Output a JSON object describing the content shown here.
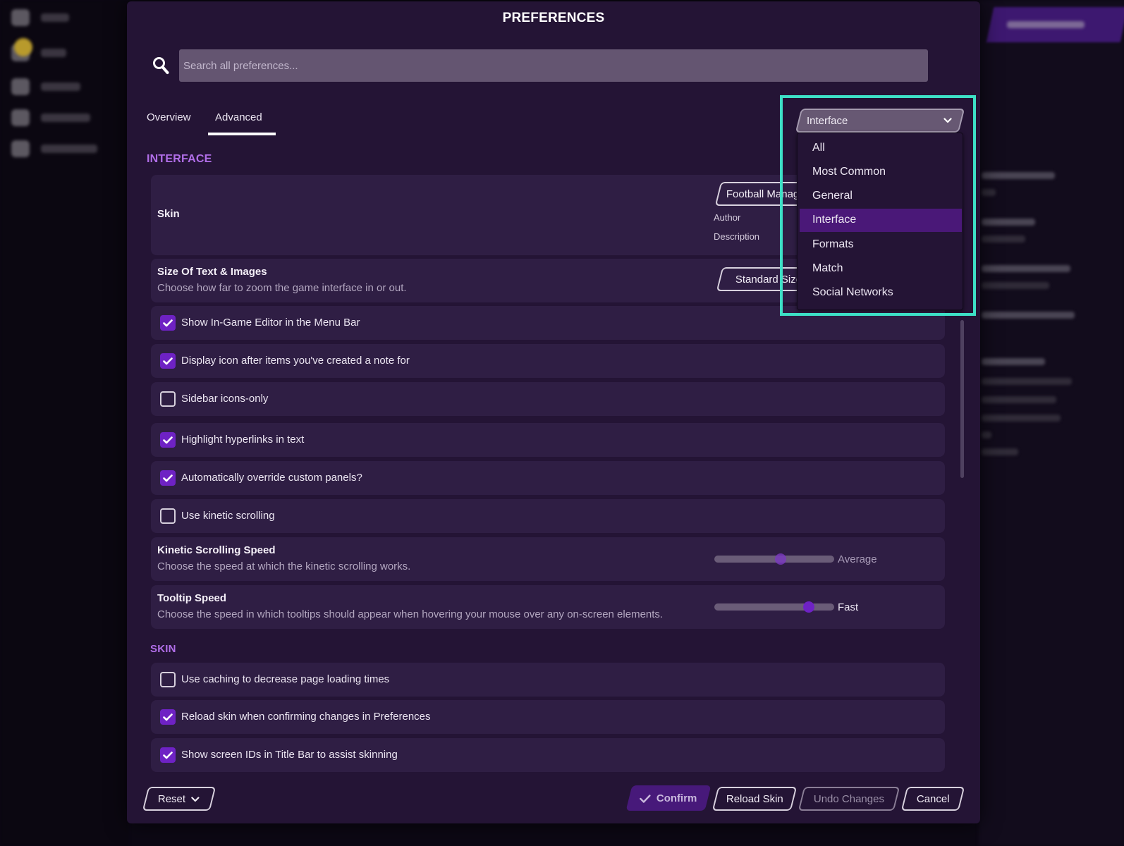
{
  "dialog": {
    "title": "PREFERENCES",
    "search": {
      "placeholder": "Search all preferences...",
      "value": ""
    },
    "tabs": [
      {
        "label": "Overview",
        "active": false
      },
      {
        "label": "Advanced",
        "active": true
      }
    ],
    "category_dropdown": {
      "selected": "Interface",
      "options": [
        "All",
        "Most Common",
        "General",
        "Interface",
        "Formats",
        "Match",
        "Social Networks"
      ],
      "highlight_color": "#3de0c6"
    },
    "sections": {
      "interface": {
        "title": "INTERFACE",
        "skin": {
          "title": "Skin",
          "value": "Football Manager",
          "author_label": "Author",
          "description_label": "Description"
        },
        "size_text": {
          "title": "Size Of Text & Images",
          "description": "Choose how far to zoom the game interface in or out.",
          "value": "Standard Size"
        },
        "checkboxes": [
          {
            "label": "Show In-Game Editor in the Menu Bar",
            "checked": true
          },
          {
            "label": "Display icon after items you've created a note for",
            "checked": true
          },
          {
            "label": "Sidebar icons-only",
            "checked": false
          },
          {
            "label": "Highlight hyperlinks in text",
            "checked": true
          },
          {
            "label": "Automatically override custom panels?",
            "checked": true
          },
          {
            "label": "Use kinetic scrolling",
            "checked": false
          }
        ],
        "kinetic_speed": {
          "title": "Kinetic Scrolling Speed",
          "description": "Choose the speed at which the kinetic scrolling works.",
          "value_label": "Average",
          "position": 0.55,
          "enabled": false
        },
        "tooltip_speed": {
          "title": "Tooltip Speed",
          "description": "Choose the speed in which tooltips should appear when hovering your mouse over any on-screen elements.",
          "value_label": "Fast",
          "position": 0.79,
          "enabled": true
        }
      },
      "skin": {
        "title": "SKIN",
        "checkboxes": [
          {
            "label": "Use caching to decrease page loading times",
            "checked": false
          },
          {
            "label": "Reload skin when confirming changes in Preferences",
            "checked": true
          },
          {
            "label": "Show screen IDs in Title Bar to assist skinning",
            "checked": true
          }
        ]
      }
    },
    "footer": {
      "reset": "Reset",
      "confirm": "Confirm",
      "reload_skin": "Reload Skin",
      "undo_changes": "Undo Changes",
      "cancel": "Cancel"
    }
  },
  "colors": {
    "accent_purple": "#6e22c4",
    "section_title": "#b16ee8",
    "dialog_bg": "#241435",
    "row_bg": "#2f1e44"
  }
}
